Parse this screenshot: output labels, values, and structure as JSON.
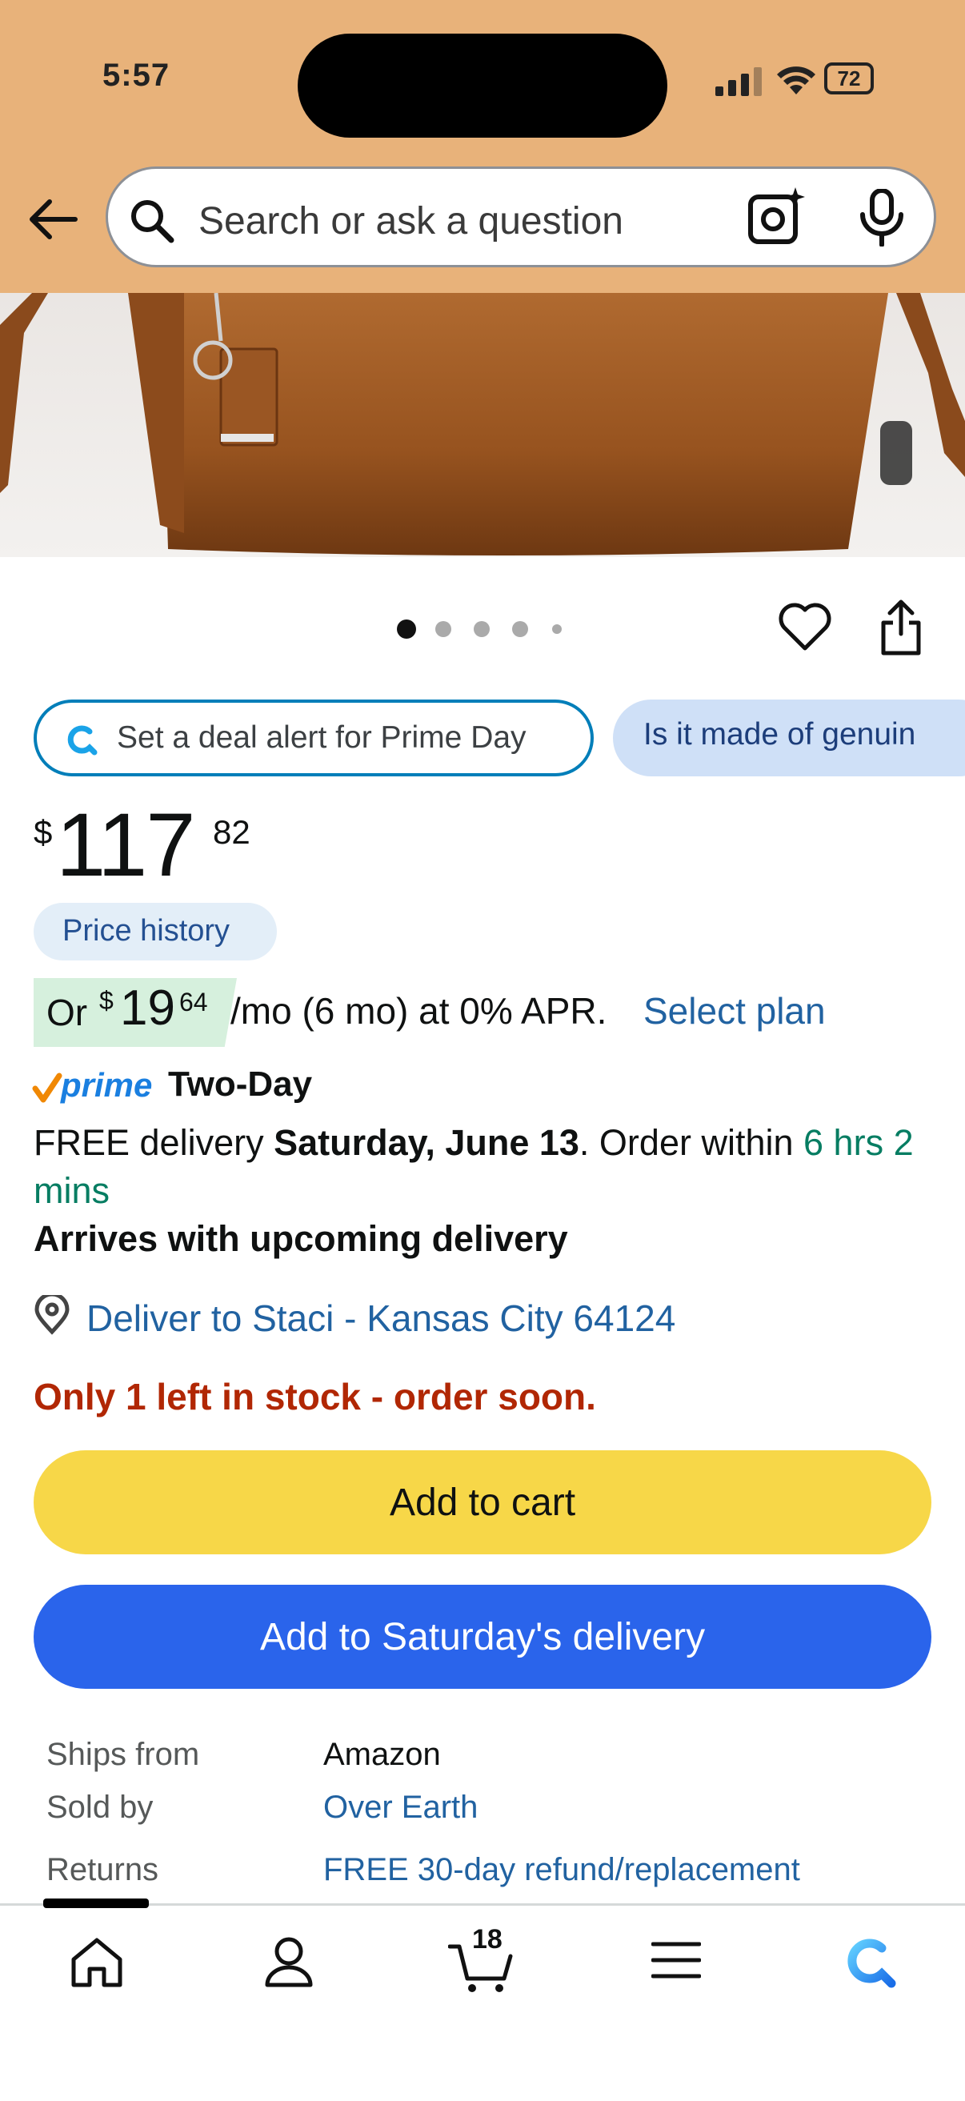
{
  "status_bar": {
    "time": "5:57",
    "battery": "72"
  },
  "search": {
    "placeholder": "Search or ask a question"
  },
  "carousel": {
    "total_dots": 5,
    "active_index": 0
  },
  "chips": {
    "deal_alert": "Set a deal alert for Prime Day",
    "question": "Is it made of genuin"
  },
  "price": {
    "symbol": "$",
    "whole": "117",
    "fraction": "82",
    "history_label": "Price history"
  },
  "monthly": {
    "prefix": "Or",
    "symbol": "$",
    "whole": "19",
    "fraction": "64",
    "terms": "/mo (6 mo) at 0% APR.",
    "select_plan": "Select plan"
  },
  "prime": {
    "brand": "prime",
    "speed": "Two-Day"
  },
  "delivery": {
    "free_text": "FREE delivery",
    "date": "Saturday, June 13",
    "order_within": ". Order within",
    "countdown": "6 hrs 2 mins",
    "arrives": "Arrives with upcoming delivery",
    "deliver_to": "Deliver to Staci - Kansas City 64124"
  },
  "stock": "Only 1 left in stock - order soon.",
  "buttons": {
    "add_to_cart": "Add to cart",
    "add_to_delivery": "Add to Saturday's delivery"
  },
  "info": {
    "ships_from_label": "Ships from",
    "ships_from_value": "Amazon",
    "sold_by_label": "Sold by",
    "sold_by_value": "Over Earth",
    "returns_label": "Returns",
    "returns_value": "FREE 30-day refund/replacement"
  },
  "nav": {
    "cart_count": "18"
  },
  "colors": {
    "header_bg": "#e8b27a",
    "cart_button": "#f7d748",
    "delivery_button": "#2a64eb",
    "link": "#2162a1",
    "stock_red": "#b12704"
  }
}
